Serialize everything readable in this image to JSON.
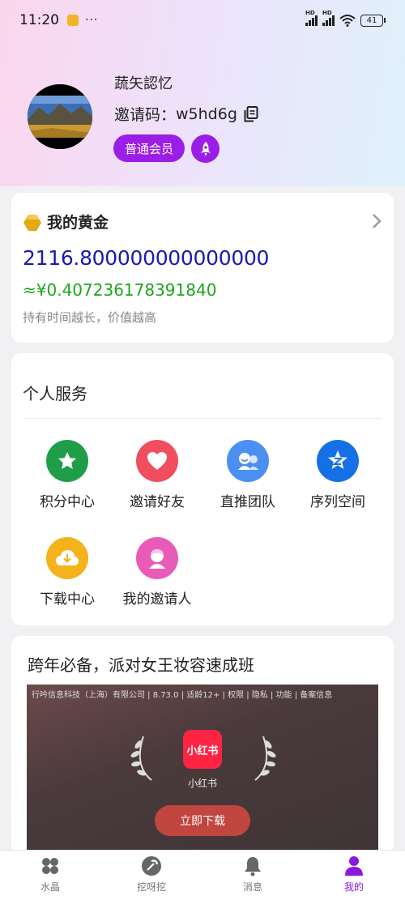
{
  "status_bar": {
    "time": "11:20",
    "dots": "···",
    "battery": "41"
  },
  "profile": {
    "username": "蔬矢認忆",
    "invite_label": "邀请码：",
    "invite_code": "w5hd6g",
    "member_level": "普通会员"
  },
  "gold": {
    "title": "我的黄金",
    "amount": "2116.800000000000000",
    "cny_value": "≈¥0.407236178391840",
    "hint": "持有时间越长，价值越高"
  },
  "services": {
    "title": "个人服务",
    "items": [
      {
        "label": "积分中心",
        "icon": "star-icon",
        "color": "#1f9e4a"
      },
      {
        "label": "邀请好友",
        "icon": "heart-icon",
        "color": "#f04d5e"
      },
      {
        "label": "直推团队",
        "icon": "team-icon",
        "color": "#4b8ff2"
      },
      {
        "label": "序列空间",
        "icon": "sequence-icon",
        "color": "#1570e6"
      },
      {
        "label": "下载中心",
        "icon": "download-icon",
        "color": "#f4b21b"
      },
      {
        "label": "我的邀请人",
        "icon": "inviter-icon",
        "color": "#e85cb7"
      }
    ]
  },
  "ad": {
    "title": "跨年必备，派对女王妆容速成班",
    "meta": "行吟信息科技（上海）有限公司 | 8.73.0 | 适龄12+ | 权限 | 隐私 | 功能 | 备案信息",
    "logo_text": "小红书",
    "app_name": "小红书",
    "cta": "立即下载"
  },
  "tabbar": {
    "items": [
      {
        "label": "水晶",
        "icon": "crystal-icon"
      },
      {
        "label": "挖呀挖",
        "icon": "dig-icon"
      },
      {
        "label": "消息",
        "icon": "bell-icon"
      },
      {
        "label": "我的",
        "icon": "user-icon",
        "active": true
      }
    ]
  },
  "colors": {
    "accent": "#9b1ee6",
    "gold_amount": "#1a1ab0",
    "gold_cny": "#1da51d"
  }
}
